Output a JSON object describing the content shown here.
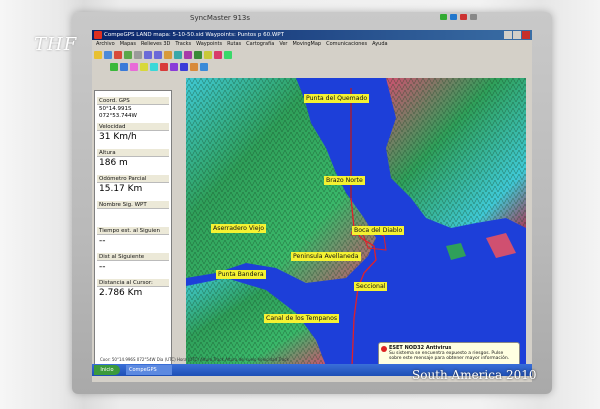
{
  "watermarks": {
    "top_left": "THF",
    "bottom_right": "South America 2010"
  },
  "monitor": {
    "brand": "SyncMaster 913s"
  },
  "window": {
    "title": "CompeGPS LAND mapa: 5-10-50.sid Waypoints: Puntos p 60.WPT"
  },
  "menu": [
    "Archivo",
    "Mapas",
    "Relieves 3D",
    "Tracks",
    "Waypoints",
    "Rutas",
    "Cartografía",
    "Ver",
    "MovingMap",
    "Comunicaciones",
    "Ayuda"
  ],
  "sidebar": {
    "fields": [
      {
        "label": "Coord. GPS",
        "value": "50°14.991S\n072°53.744W"
      },
      {
        "label": "Velocidad",
        "value": "31 Km/h"
      },
      {
        "label": "Altura",
        "value": "186 m"
      },
      {
        "label": "Odómetro Parcial",
        "value": "15.17 Km"
      },
      {
        "label": "Nombre Sig. WPT",
        "value": ""
      },
      {
        "label": "Tiempo est. al Siguien",
        "value": "--"
      },
      {
        "label": "Dist al Siguiente",
        "value": "--"
      },
      {
        "label": "Distancia al Cursor:",
        "value": "2.786 Km"
      }
    ]
  },
  "map": {
    "waypoints": [
      "Punta del Quemado",
      "Brazo Norte",
      "Aserradero Viejo",
      "Boca del Diablo",
      "Peninsula Avellaneda",
      "Punta Bandera",
      "Seccional",
      "Canal de los Tempanos"
    ],
    "colors": {
      "water": "#1d3fd9",
      "land_low": "#2fa05a",
      "land_high": "#d05070",
      "ice": "#3fc9d6",
      "track": "#e0202a"
    }
  },
  "statusbar": {
    "text": "Coor: 50°14.996S 072°54W Dia (UTC)   Hora (UTC)   Altura Track   Altura del suelo   Velocidad Track"
  },
  "taskbar": {
    "start": "Inicio",
    "task": "CompeGPS"
  },
  "notification": {
    "title": "ESET NOD32 Antivirus",
    "body": "Su sistema se encuentra expuesto a riesgos. Pulse sobre este mensaje para obtener mayor información."
  }
}
